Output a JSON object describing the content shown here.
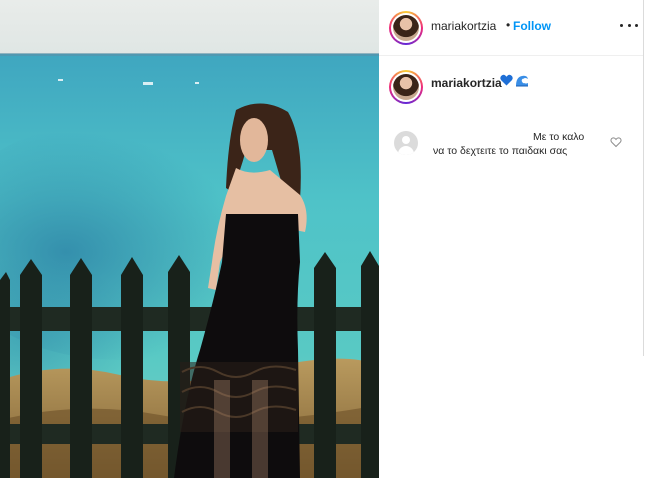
{
  "post": {
    "username": "mariakortzia",
    "separator": "•",
    "follow_label": "Follow",
    "more_icon": "more-options-icon"
  },
  "caption": {
    "username": "mariakortzia",
    "emojis": [
      "blue-heart-emoji",
      "water-wave-emoji"
    ]
  },
  "comments": [
    {
      "avatar": "default-avatar-icon",
      "line1": "Με το καλο",
      "line2": "να το δεχτειτε το παιδακι σας",
      "like_icon": "heart-outline-icon"
    }
  ],
  "colors": {
    "follow_blue": "#0095f6",
    "text": "#262626",
    "divider": "#efefef"
  }
}
